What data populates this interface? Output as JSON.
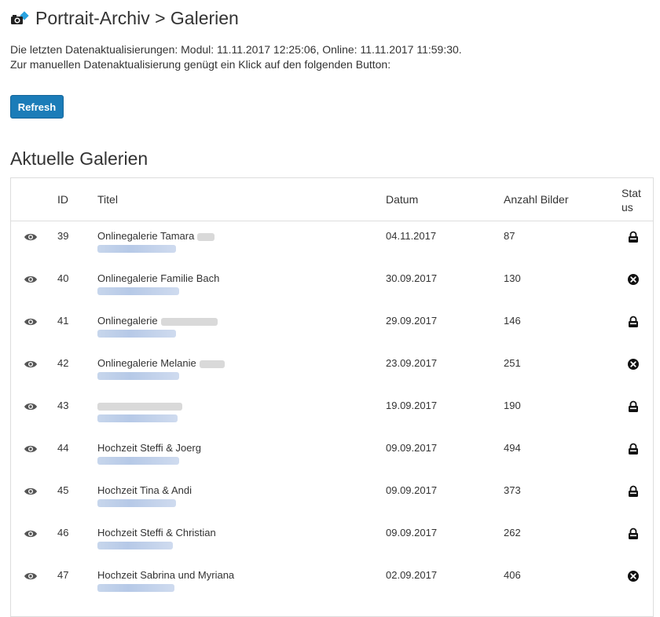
{
  "header": {
    "title": "Portrait-Archiv > Galerien",
    "logo_icon": "camera-logo-icon"
  },
  "info": {
    "line1": "Die letzten Datenaktualisierungen: Modul: 11.11.2017 12:25:06, Online: 11.11.2017 11:59:30.",
    "line2": "Zur manuellen Datenaktualisierung genügt ein Klick auf den folgenden Button:"
  },
  "refresh_label": "Refresh",
  "section_title": "Aktuelle Galerien",
  "table": {
    "columns": {
      "id": "ID",
      "title": "Titel",
      "date": "Datum",
      "count": "Anzahl Bilder",
      "status": "Stat us"
    },
    "rows": [
      {
        "id": "39",
        "title": "Onlinegalerie Tamara",
        "date": "04.11.2017",
        "count": "87",
        "status": "locked"
      },
      {
        "id": "40",
        "title": "Onlinegalerie Familie Bach",
        "date": "30.09.2017",
        "count": "130",
        "status": "closed"
      },
      {
        "id": "41",
        "title": "Onlinegalerie",
        "date": "29.09.2017",
        "count": "146",
        "status": "locked"
      },
      {
        "id": "42",
        "title": "Onlinegalerie Melanie",
        "date": "23.09.2017",
        "count": "251",
        "status": "closed"
      },
      {
        "id": "43",
        "title": "",
        "date": "19.09.2017",
        "count": "190",
        "status": "locked"
      },
      {
        "id": "44",
        "title": "Hochzeit Steffi & Joerg",
        "date": "09.09.2017",
        "count": "494",
        "status": "locked"
      },
      {
        "id": "45",
        "title": "Hochzeit Tina & Andi",
        "date": "09.09.2017",
        "count": "373",
        "status": "locked"
      },
      {
        "id": "46",
        "title": "Hochzeit Steffi & Christian",
        "date": "09.09.2017",
        "count": "262",
        "status": "locked"
      },
      {
        "id": "47",
        "title": "Hochzeit Sabrina und Myriana",
        "date": "02.09.2017",
        "count": "406",
        "status": "closed"
      }
    ]
  },
  "colors": {
    "button": "#1b7cb8",
    "link_blur": "#b6c9e7"
  }
}
